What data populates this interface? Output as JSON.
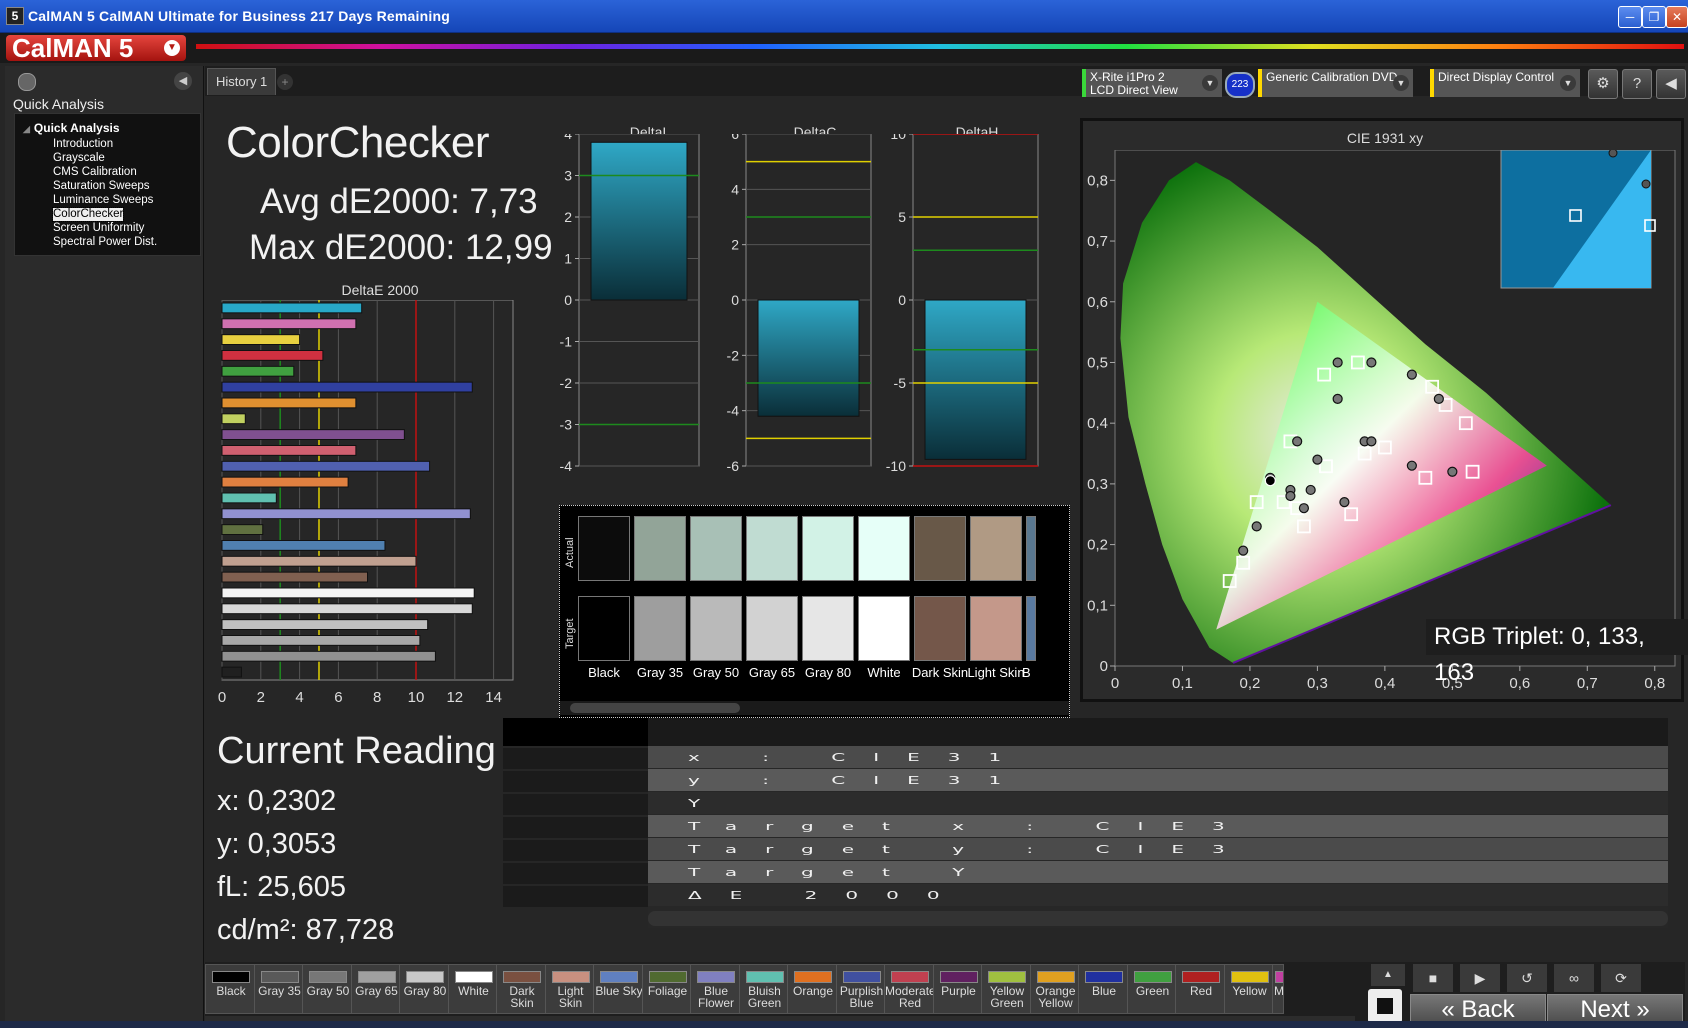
{
  "window": {
    "title": "CalMAN 5 CalMAN Ultimate for Business 217 Days Remaining",
    "app_icon": "5",
    "buttons": [
      "minimize",
      "maximize",
      "close"
    ]
  },
  "brand": {
    "logo": "CalMAN 5",
    "dropdown_icon": "chevron-down-icon"
  },
  "sidebar": {
    "heading": "Quick Analysis",
    "tree_root": "Quick Analysis",
    "items": [
      "Introduction",
      "Grayscale",
      "CMS Calibration",
      "Saturation Sweeps",
      "Luminance Sweeps",
      "ColorChecker",
      "Screen Uniformity",
      "Spectral Power Dist."
    ],
    "selected": "ColorChecker"
  },
  "tabs": {
    "active": "History 1"
  },
  "devices": {
    "meter": {
      "line1": "X-Rite i1Pro 2",
      "line2": "LCD Direct View",
      "badge": "223",
      "accent": "#3ad83a"
    },
    "source": {
      "label": "Generic Calibration DVD",
      "accent": "#ffd800"
    },
    "display": {
      "label": "Direct Display Control",
      "accent": "#ffd800"
    }
  },
  "summary": {
    "title": "ColorChecker",
    "avg_label": "Avg dE2000: 7,73",
    "max_label": "Max dE2000: 12,99"
  },
  "charts": {
    "deltaE": {
      "title": "DeltaE 2000",
      "type": "bar",
      "x_ticks": [
        "0",
        "2",
        "4",
        "6",
        "8",
        "10",
        "12",
        "14"
      ],
      "xlim": [
        0,
        15
      ],
      "thresholds": [
        {
          "value": 3,
          "color": "#1d8a1d"
        },
        {
          "value": 5,
          "color": "#e0d000"
        },
        {
          "value": 10,
          "color": "#c01010"
        }
      ],
      "bars": [
        {
          "value": 7.2,
          "color": "#28a8c8"
        },
        {
          "value": 6.9,
          "color": "#d070b0"
        },
        {
          "value": 4.0,
          "color": "#e8d040"
        },
        {
          "value": 5.2,
          "color": "#d03040"
        },
        {
          "value": 3.7,
          "color": "#40a040"
        },
        {
          "value": 12.9,
          "color": "#3040a0"
        },
        {
          "value": 6.9,
          "color": "#e09030"
        },
        {
          "value": 1.2,
          "color": "#c0d060"
        },
        {
          "value": 9.4,
          "color": "#805090"
        },
        {
          "value": 6.9,
          "color": "#d06070"
        },
        {
          "value": 10.7,
          "color": "#5060b0"
        },
        {
          "value": 6.5,
          "color": "#e08040"
        },
        {
          "value": 2.8,
          "color": "#60c0b0"
        },
        {
          "value": 12.8,
          "color": "#9090d0"
        },
        {
          "value": 2.1,
          "color": "#607040"
        },
        {
          "value": 8.4,
          "color": "#5080b0"
        },
        {
          "value": 10.0,
          "color": "#c0a090"
        },
        {
          "value": 7.5,
          "color": "#806050"
        },
        {
          "value": 13.0,
          "color": "#f4f4f4"
        },
        {
          "value": 12.9,
          "color": "#d8d8d8"
        },
        {
          "value": 10.6,
          "color": "#c0c0c0"
        },
        {
          "value": 10.2,
          "color": "#a8a8a8"
        },
        {
          "value": 11.0,
          "color": "#909090"
        },
        {
          "value": 1.0,
          "color": "#202020"
        }
      ]
    },
    "deltaL": {
      "title": "DeltaL",
      "type": "bar",
      "ylim": [
        -4,
        4
      ],
      "y_ticks": [
        "4",
        "3",
        "2",
        "1",
        "0",
        "-1",
        "-2",
        "-3",
        "-4"
      ],
      "value": 3.8,
      "green_lines": [
        3,
        -3
      ],
      "yellow_lines": [],
      "red_lines": []
    },
    "deltaC": {
      "title": "DeltaC",
      "type": "bar",
      "ylim": [
        -6,
        6
      ],
      "y_ticks": [
        "6",
        "4",
        "2",
        "0",
        "-2",
        "-4",
        "-6"
      ],
      "value": -4.2,
      "green_lines": [
        3,
        -3
      ],
      "yellow_lines": [
        5,
        -5
      ],
      "red_lines": []
    },
    "deltaH": {
      "title": "DeltaH",
      "type": "bar",
      "ylim": [
        -10,
        10
      ],
      "y_ticks": [
        "10",
        "5",
        "0",
        "-5",
        "-10"
      ],
      "value": -9.6,
      "green_lines": [
        3,
        -3
      ],
      "yellow_lines": [
        5,
        -5
      ],
      "red_lines": [
        10,
        -10
      ]
    }
  },
  "patches": {
    "actual_label": "Actual",
    "target_label": "Target",
    "items": [
      {
        "name": "Black",
        "actual": "#0c0c0c",
        "target": "#000000"
      },
      {
        "name": "Gray 35",
        "actual": "#92a498",
        "target": "#9e9e9e"
      },
      {
        "name": "Gray 50",
        "actual": "#a8c0b6",
        "target": "#bababa"
      },
      {
        "name": "Gray 65",
        "actual": "#c0dcd2",
        "target": "#d2d2d2"
      },
      {
        "name": "Gray 80",
        "actual": "#d2f2e6",
        "target": "#e6e6e6"
      },
      {
        "name": "White",
        "actual": "#e6fff8",
        "target": "#ffffff"
      },
      {
        "name": "Dark Skin",
        "actual": "#685848",
        "target": "#74574a"
      },
      {
        "name": "Light Skin",
        "actual": "#b09a84",
        "target": "#c4988a"
      },
      {
        "name": "B",
        "actual": "#5a7890",
        "target": "#5a7aa0"
      }
    ]
  },
  "cie": {
    "title": "CIE 1931 xy",
    "x_ticks": [
      "0",
      "0,1",
      "0,2",
      "0,3",
      "0,4",
      "0,5",
      "0,6",
      "0,7",
      "0,8"
    ],
    "y_ticks": [
      "0,8",
      "0,7",
      "0,6",
      "0,5",
      "0,4",
      "0,3",
      "0,2",
      "0,1",
      "0"
    ],
    "xlim": [
      0,
      0.83
    ],
    "ylim": [
      0,
      0.85
    ],
    "gamut": [
      [
        0.64,
        0.33
      ],
      [
        0.3,
        0.6
      ],
      [
        0.15,
        0.06
      ]
    ],
    "targets": [
      [
        0.3127,
        0.329
      ],
      [
        0.26,
        0.37
      ],
      [
        0.31,
        0.48
      ],
      [
        0.36,
        0.5
      ],
      [
        0.47,
        0.46
      ],
      [
        0.49,
        0.43
      ],
      [
        0.52,
        0.4
      ],
      [
        0.4,
        0.36
      ],
      [
        0.37,
        0.35
      ],
      [
        0.46,
        0.31
      ],
      [
        0.53,
        0.32
      ],
      [
        0.35,
        0.25
      ],
      [
        0.28,
        0.23
      ],
      [
        0.21,
        0.27
      ],
      [
        0.25,
        0.27
      ],
      [
        0.27,
        0.26
      ],
      [
        0.19,
        0.17
      ],
      [
        0.17,
        0.14
      ]
    ],
    "actuals": [
      [
        0.3,
        0.34
      ],
      [
        0.27,
        0.37
      ],
      [
        0.33,
        0.5
      ],
      [
        0.38,
        0.5
      ],
      [
        0.44,
        0.48
      ],
      [
        0.48,
        0.44
      ],
      [
        0.33,
        0.44
      ],
      [
        0.37,
        0.37
      ],
      [
        0.38,
        0.37
      ],
      [
        0.44,
        0.33
      ],
      [
        0.5,
        0.32
      ],
      [
        0.34,
        0.27
      ],
      [
        0.28,
        0.26
      ],
      [
        0.23,
        0.31
      ],
      [
        0.26,
        0.29
      ],
      [
        0.26,
        0.28
      ],
      [
        0.21,
        0.23
      ],
      [
        0.19,
        0.19
      ],
      [
        0.29,
        0.29
      ]
    ],
    "current": [
      0.2302,
      0.3053
    ],
    "rgb_triplet": "RGB Triplet: 0, 133, 163"
  },
  "reading": {
    "title": "Current Reading",
    "x": "x: 0,2302",
    "y": "y: 0,3053",
    "fl": "fL: 25,605",
    "cdm2": "cd/m²: 87,728"
  },
  "table": {
    "rows": [
      "x : CIE31",
      "y : CIE31",
      "Y",
      "Target x : CIE3",
      "Target y : CIE3",
      "Target Y",
      "ΔE 2000"
    ]
  },
  "bottom": {
    "swatches": [
      {
        "label": "Black",
        "color": "#000000"
      },
      {
        "label": "Gray 35",
        "color": "#595959"
      },
      {
        "label": "Gray 50",
        "color": "#777777"
      },
      {
        "label": "Gray 65",
        "color": "#a0a0a0"
      },
      {
        "label": "Gray 80",
        "color": "#c8c8c8"
      },
      {
        "label": "White",
        "color": "#ffffff"
      },
      {
        "label": "Dark Skin",
        "color": "#7a5040"
      },
      {
        "label": "Light Skin",
        "color": "#c89080"
      },
      {
        "label": "Blue Sky",
        "color": "#6080c0"
      },
      {
        "label": "Foliage",
        "color": "#506a30"
      },
      {
        "label": "Blue Flower",
        "color": "#8080c0"
      },
      {
        "label": "Bluish Green",
        "color": "#60c0b0"
      },
      {
        "label": "Orange",
        "color": "#e07020"
      },
      {
        "label": "Purplish Blue",
        "color": "#4050a0"
      },
      {
        "label": "Moderate Red",
        "color": "#c04050"
      },
      {
        "label": "Purple",
        "color": "#602060"
      },
      {
        "label": "Yellow Green",
        "color": "#a0c040"
      },
      {
        "label": "Orange Yellow",
        "color": "#e0a020"
      },
      {
        "label": "Blue",
        "color": "#2030a0"
      },
      {
        "label": "Green",
        "color": "#40a040"
      },
      {
        "label": "Red",
        "color": "#b02020"
      },
      {
        "label": "Yellow",
        "color": "#e0c010"
      },
      {
        "label": "M",
        "color": "#c040a0"
      }
    ],
    "back": "Back",
    "next": "Next"
  }
}
